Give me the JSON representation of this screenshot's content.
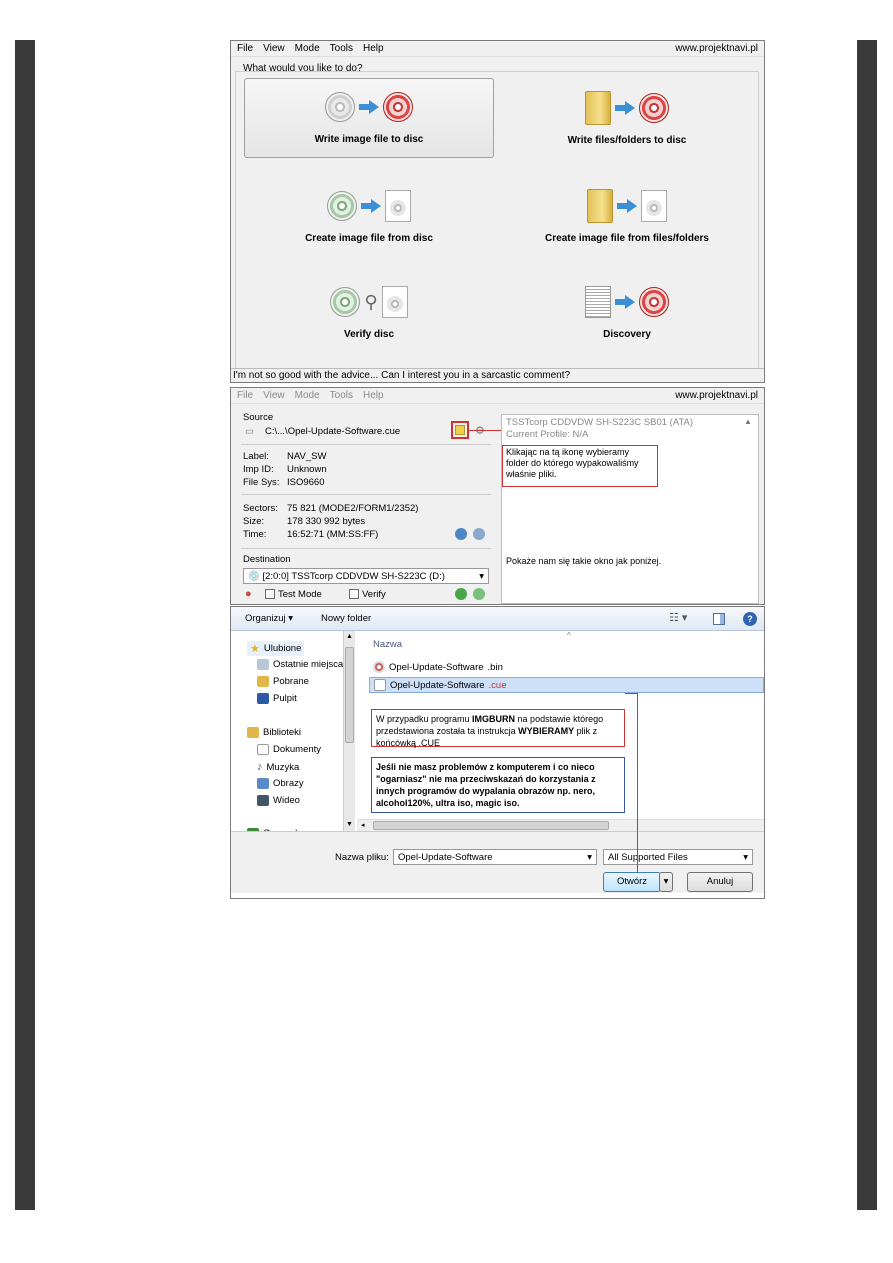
{
  "colors": {
    "accent": "#3a8fd6",
    "highlight_red": "#cc3333",
    "selection": "#cde0f7"
  },
  "menu": {
    "file": "File",
    "view": "View",
    "mode": "Mode",
    "tools": "Tools",
    "help": "Help",
    "brand": "www.projektnavi.pl"
  },
  "wizard": {
    "heading": "What would you like to do?",
    "items": [
      {
        "label": "Write image file to disc"
      },
      {
        "label": "Write files/folders to disc"
      },
      {
        "label": "Create image file from disc"
      },
      {
        "label": "Create image file from files/folders"
      },
      {
        "label": "Verify disc"
      },
      {
        "label": "Discovery"
      }
    ],
    "status": "I'm not so good with the advice... Can I interest you in a sarcastic comment?"
  },
  "write": {
    "source_label": "Source",
    "source_path": "C:\\...\\Opel-Update-Software.cue",
    "label_key": "Label:",
    "label_val": "NAV_SW",
    "impid_key": "Imp ID:",
    "impid_val": "Unknown",
    "fs_key": "File Sys:",
    "fs_val": "ISO9660",
    "sectors_key": "Sectors:",
    "sectors_val": "75 821 (MODE2/FORM1/2352)",
    "size_key": "Size:",
    "size_val": "178 330 992 bytes",
    "time_key": "Time:",
    "time_val": "16:52:71 (MM:SS:FF)",
    "dest_label": "Destination",
    "dest_drive": "[2:0:0] TSSTcorp CDDVDW SH-S223C (D:)",
    "test_mode": "Test Mode",
    "verify": "Verify",
    "device_line1": "TSSTcorp CDDVDW SH-S223C SB01 (ATA)",
    "device_line2": "Current Profile: N/A",
    "annotation1": "Klikając na tą ikonę wybieramy folder do którego wypakowaliśmy właśnie pliki.",
    "annotation2": "Pokaże nam się takie okno jak poniżej."
  },
  "dialog": {
    "organize": "Organizuj ▾",
    "new_folder": "Nowy folder",
    "nav": {
      "favorites": "Ulubione",
      "recent": "Ostatnie miejsca",
      "downloads": "Pobrane",
      "desktop": "Pulpit",
      "libraries": "Biblioteki",
      "documents": "Dokumenty",
      "music": "Muzyka",
      "pictures": "Obrazy",
      "videos": "Wideo",
      "homegroup": "Grupa domowa"
    },
    "column_name": "Nazwa",
    "files": [
      {
        "name": "Opel-Update-Software",
        "ext": ".bin"
      },
      {
        "name": "Opel-Update-Software",
        "ext": ".cue"
      }
    ],
    "note1_a": "W przypadku programu ",
    "note1_b": "IMGBURN",
    "note1_c": " na podstawie którego przedstawiona została ta instrukcja ",
    "note1_d": "WYBIERAMY",
    "note1_e": " plik z końcówką .CUE",
    "note2": "Jeśli nie masz problemów z komputerem i co nieco \"ogarniasz\" nie ma przeciwskazań do korzystania z innych programów do wypalania obrazów np. nero, alcohol120%, ultra iso, magic iso.",
    "filename_label": "Nazwa pliku:",
    "filename_value": "Opel-Update-Software",
    "filter": "All Supported Files",
    "open": "Otwórz",
    "cancel": "Anuluj"
  }
}
